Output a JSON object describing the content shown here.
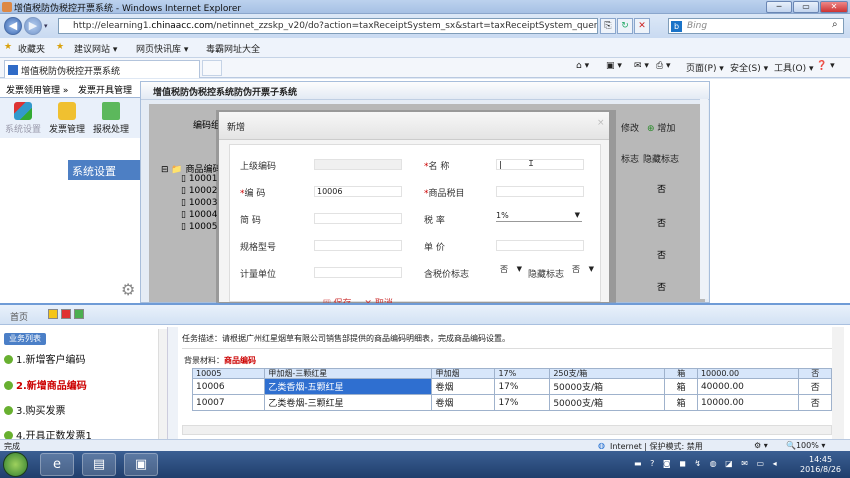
{
  "window": {
    "title": "增值税防伪税控开票系统 - Windows Internet Explorer"
  },
  "browser": {
    "url_prefix": "http://elearning1.",
    "url_domain": "chinaacc.com",
    "url_suffix": "/netinnet_zzskp_v20/do?action=taxReceiptSystem_sx&start=taxReceiptSystem_query&studentid=57bb5",
    "search_placeholder": "Bing",
    "favorites_label": "收藏夹",
    "fav_links": [
      "建议网站 ▾",
      "网页快讯库 ▾",
      "毒霸网址大全"
    ],
    "tab_title": "增值税防伪税控开票系统",
    "cmd_page": "页面(P) ▾",
    "cmd_safety": "安全(S) ▾",
    "cmd_tools": "工具(O) ▾",
    "cmd_help": "❓ ▾"
  },
  "app": {
    "menu": [
      "发票领用管理 »",
      "发票开具管理"
    ],
    "tools": [
      "系统设置",
      "发票管理",
      "报税处理"
    ],
    "side_header": "系统设置",
    "panel_title": "增值税防伪税控系统防伪开票子系统",
    "code_header": "编码组",
    "tree": [
      "商品编码",
      "10001",
      "10002",
      "10003",
      "10004",
      "10005"
    ],
    "actions": {
      "modify": "修改",
      "add": "增加"
    },
    "col_headers": [
      "标志",
      "隐藏标志"
    ],
    "right_values": [
      "否",
      "否",
      "否",
      "否",
      "否"
    ]
  },
  "dialog": {
    "title": "新增",
    "close": "×",
    "fields": {
      "parent_code_label": "上级编码",
      "parent_code_value": "",
      "name_label": "名  称",
      "name_value": "",
      "code_label": "编  码",
      "code_value": "10006",
      "tax_item_label": "商品税目",
      "tax_item_value": "",
      "short_code_label": "简  码",
      "short_code_value": "",
      "tax_rate_label": "税 率",
      "tax_rate_value": "1%",
      "model_label": "规格型号",
      "model_value": "",
      "unit_price_label": "单 价",
      "unit_price_value": "",
      "unit_label": "计量单位",
      "unit_value": "",
      "tax_incl_label": "含税价标志",
      "tax_incl_value": "否",
      "hidden_label": "隐藏标志",
      "hidden_value": "否"
    },
    "save": "保存",
    "cancel": "取消"
  },
  "tutorial": {
    "home": "首页",
    "list_header": "业务列表",
    "tasks": [
      "1.新增客户编码",
      "2.新增商品编码",
      "3.购买发票",
      "4.开具正数发票1"
    ],
    "task_desc": "任务描述：请根据广州红星烟草有限公司销售部提供的商品编码明细表，完成商品编码设置。",
    "bg_label": "背景材料：",
    "bg_value": "商品编码",
    "table": [
      [
        "10005",
        "甲加烟-三颗红星",
        "甲加烟",
        "17%",
        "250支/箱",
        "箱",
        "10000.00",
        "否"
      ],
      [
        "10006",
        "乙类香烟-五颗红星",
        "卷烟",
        "17%",
        "50000支/箱",
        "箱",
        "40000.00",
        "否"
      ],
      [
        "10007",
        "乙类卷烟-三颗红星",
        "卷烟",
        "17%",
        "50000支/箱",
        "箱",
        "10000.00",
        "否"
      ]
    ]
  },
  "statusbar": {
    "left": "完成",
    "zone": "Internet | 保护模式: 禁用",
    "zoom": "🔍100% ▾"
  },
  "taskbar": {
    "time": "14:45",
    "date": "2016/8/26"
  }
}
